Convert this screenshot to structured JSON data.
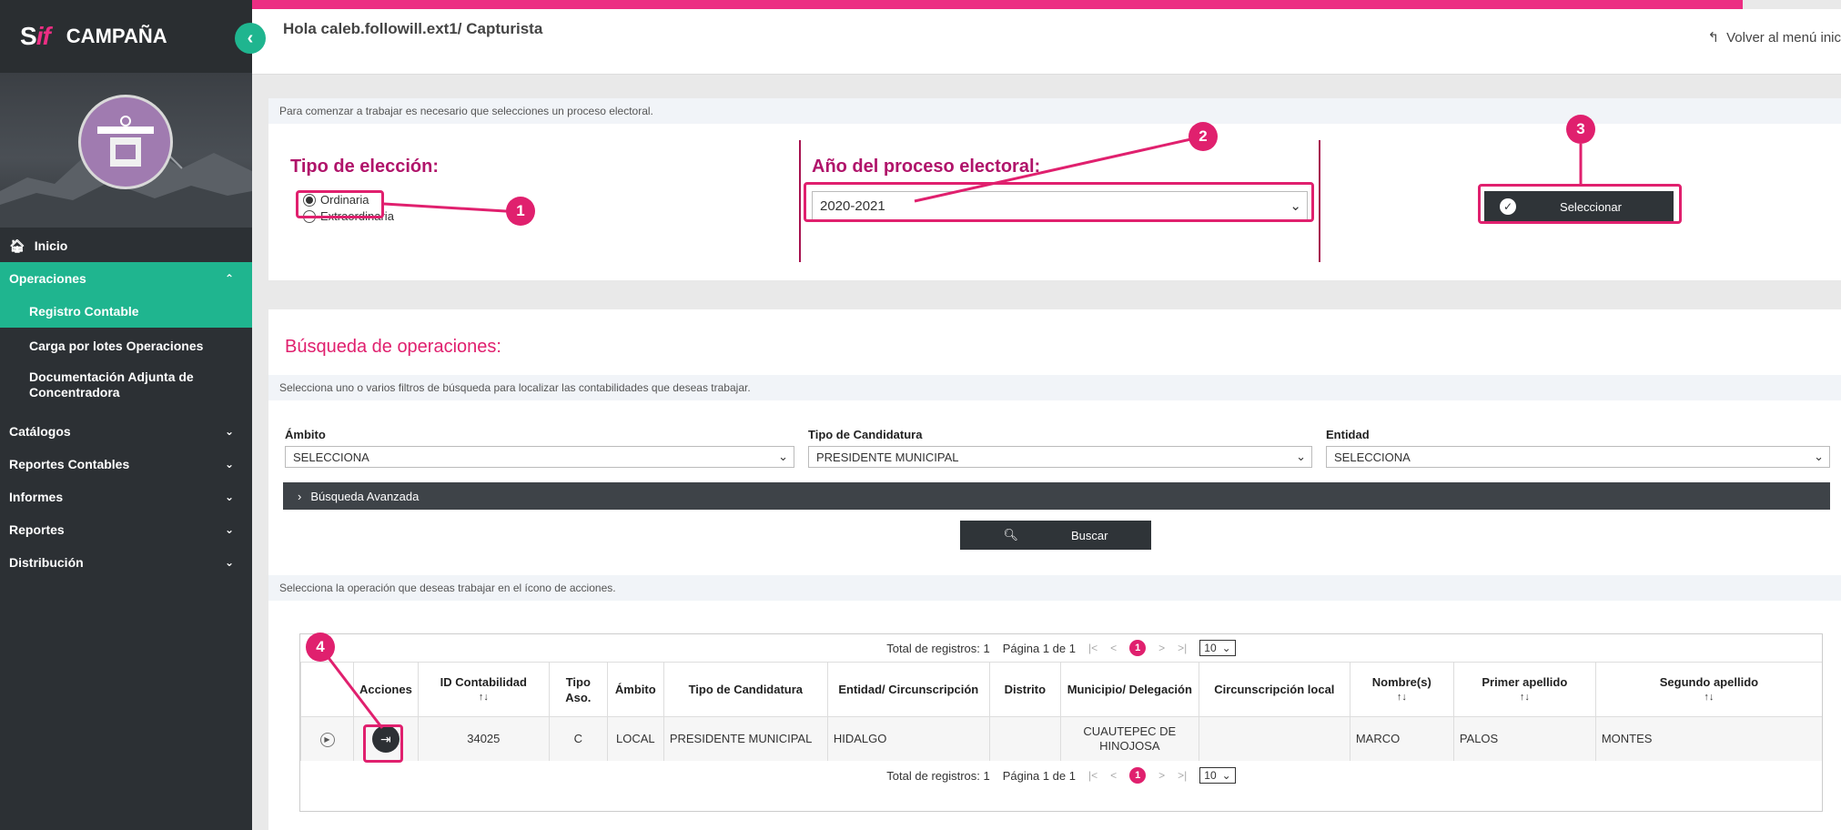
{
  "brand": {
    "logo": "SIF",
    "title": "CAMPAÑA"
  },
  "sidebar": {
    "items": [
      {
        "label": "Inicio"
      },
      {
        "label": "Operaciones"
      },
      {
        "label": "Registro Contable"
      },
      {
        "label": "Carga por lotes Operaciones"
      },
      {
        "label": "Documentación Adjunta de Concentradora"
      },
      {
        "label": "Catálogos"
      },
      {
        "label": "Reportes Contables"
      },
      {
        "label": "Informes"
      },
      {
        "label": "Reportes"
      },
      {
        "label": "Distribución"
      }
    ]
  },
  "header": {
    "greeting": "Hola caleb.followill.ext1/ Capturista",
    "back_link": "Volver al menú inic"
  },
  "process": {
    "info": "Para comenzar a trabajar es necesario que selecciones un proceso electoral.",
    "tipo_title": "Tipo de elección:",
    "options": [
      "Ordinaria",
      "Extraordinaria"
    ],
    "selected_option": "Ordinaria",
    "anio_title": "Año del proceso electoral:",
    "anio_value": "2020-2021",
    "select_button": "Seleccionar"
  },
  "search": {
    "title": "Búsqueda de operaciones:",
    "info": "Selecciona uno o varios filtros de búsqueda para localizar las contabilidades que deseas trabajar.",
    "ambito_label": "Ámbito",
    "ambito_value": "SELECCIONA",
    "tipo_label": "Tipo de Candidatura",
    "tipo_value": "PRESIDENTE MUNICIPAL",
    "entidad_label": "Entidad",
    "entidad_value": "SELECCIONA",
    "advanced": "Búsqueda Avanzada",
    "buscar": "Buscar",
    "select_info": "Selecciona la operación que deseas trabajar en el ícono de acciones."
  },
  "table": {
    "total": "Total de registros: 1",
    "page": "Página 1 de 1",
    "current_page": "1",
    "page_size": "10",
    "headers": [
      "Acciones",
      "ID Contabilidad",
      "Tipo Aso.",
      "Ámbito",
      "Tipo de Candidatura",
      "Entidad/ Circunscripción",
      "Distrito",
      "Municipio/ Delegación",
      "Circunscripción local",
      "Nombre(s)",
      "Primer apellido",
      "Segundo apellido"
    ],
    "row": {
      "id": "34025",
      "tipo_aso": "C",
      "ambito": "LOCAL",
      "tipo_candidatura": "PRESIDENTE MUNICIPAL",
      "entidad": "HIDALGO",
      "distrito": "",
      "municipio": "CUAUTEPEC DE HINOJOSA",
      "circ_local": "",
      "nombre": "MARCO",
      "primer_apellido": "PALOS",
      "segundo_apellido": "MONTES"
    }
  },
  "annotations": [
    "1",
    "2",
    "3",
    "4"
  ],
  "colors": {
    "accent": "#e0206e",
    "sidebar": "#2c3034",
    "green": "#1fb58f"
  }
}
